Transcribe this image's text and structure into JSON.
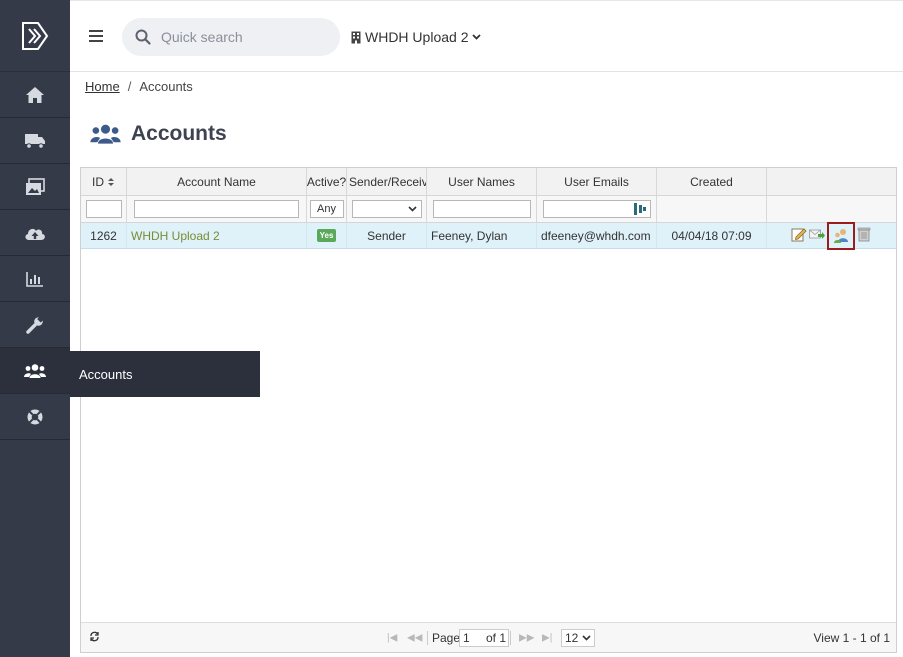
{
  "topbar": {
    "search_placeholder": "Quick search",
    "org_name": "WHDH Upload 2"
  },
  "sidebar": {
    "items": [
      {
        "icon": "home-icon"
      },
      {
        "icon": "truck-icon"
      },
      {
        "icon": "images-icon"
      },
      {
        "icon": "cloud-upload-icon"
      },
      {
        "icon": "chart-icon"
      },
      {
        "icon": "wrench-icon"
      },
      {
        "icon": "users-icon",
        "label": "Accounts",
        "active": true
      },
      {
        "icon": "life-ring-icon"
      }
    ]
  },
  "breadcrumb": {
    "home": "Home",
    "separator": "/",
    "current": "Accounts"
  },
  "page": {
    "title": "Accounts"
  },
  "table": {
    "columns": {
      "id": "ID",
      "account_name": "Account Name",
      "active": "Active?",
      "sender_receiver": "Sender/Receiver",
      "user_names": "User Names",
      "user_emails": "User Emails",
      "created": "Created"
    },
    "filters": {
      "active": "Any"
    },
    "rows": [
      {
        "id": "1262",
        "account_name": "WHDH Upload 2",
        "active": "Yes",
        "sender_receiver": "Sender",
        "user_names": "Feeney, Dylan",
        "user_emails": "dfeeney@whdh.com",
        "created": "04/04/18 07:09"
      }
    ]
  },
  "pager": {
    "page_label": "Page",
    "page_value": "1",
    "of_label": "of 1",
    "rows_per_page": "12",
    "view_text": "View 1 - 1 of 1"
  },
  "colors": {
    "sidebar": "#343a48",
    "row_selected": "#dff1f9",
    "link": "#7a8c34",
    "highlight_border": "#9b1c1c"
  }
}
